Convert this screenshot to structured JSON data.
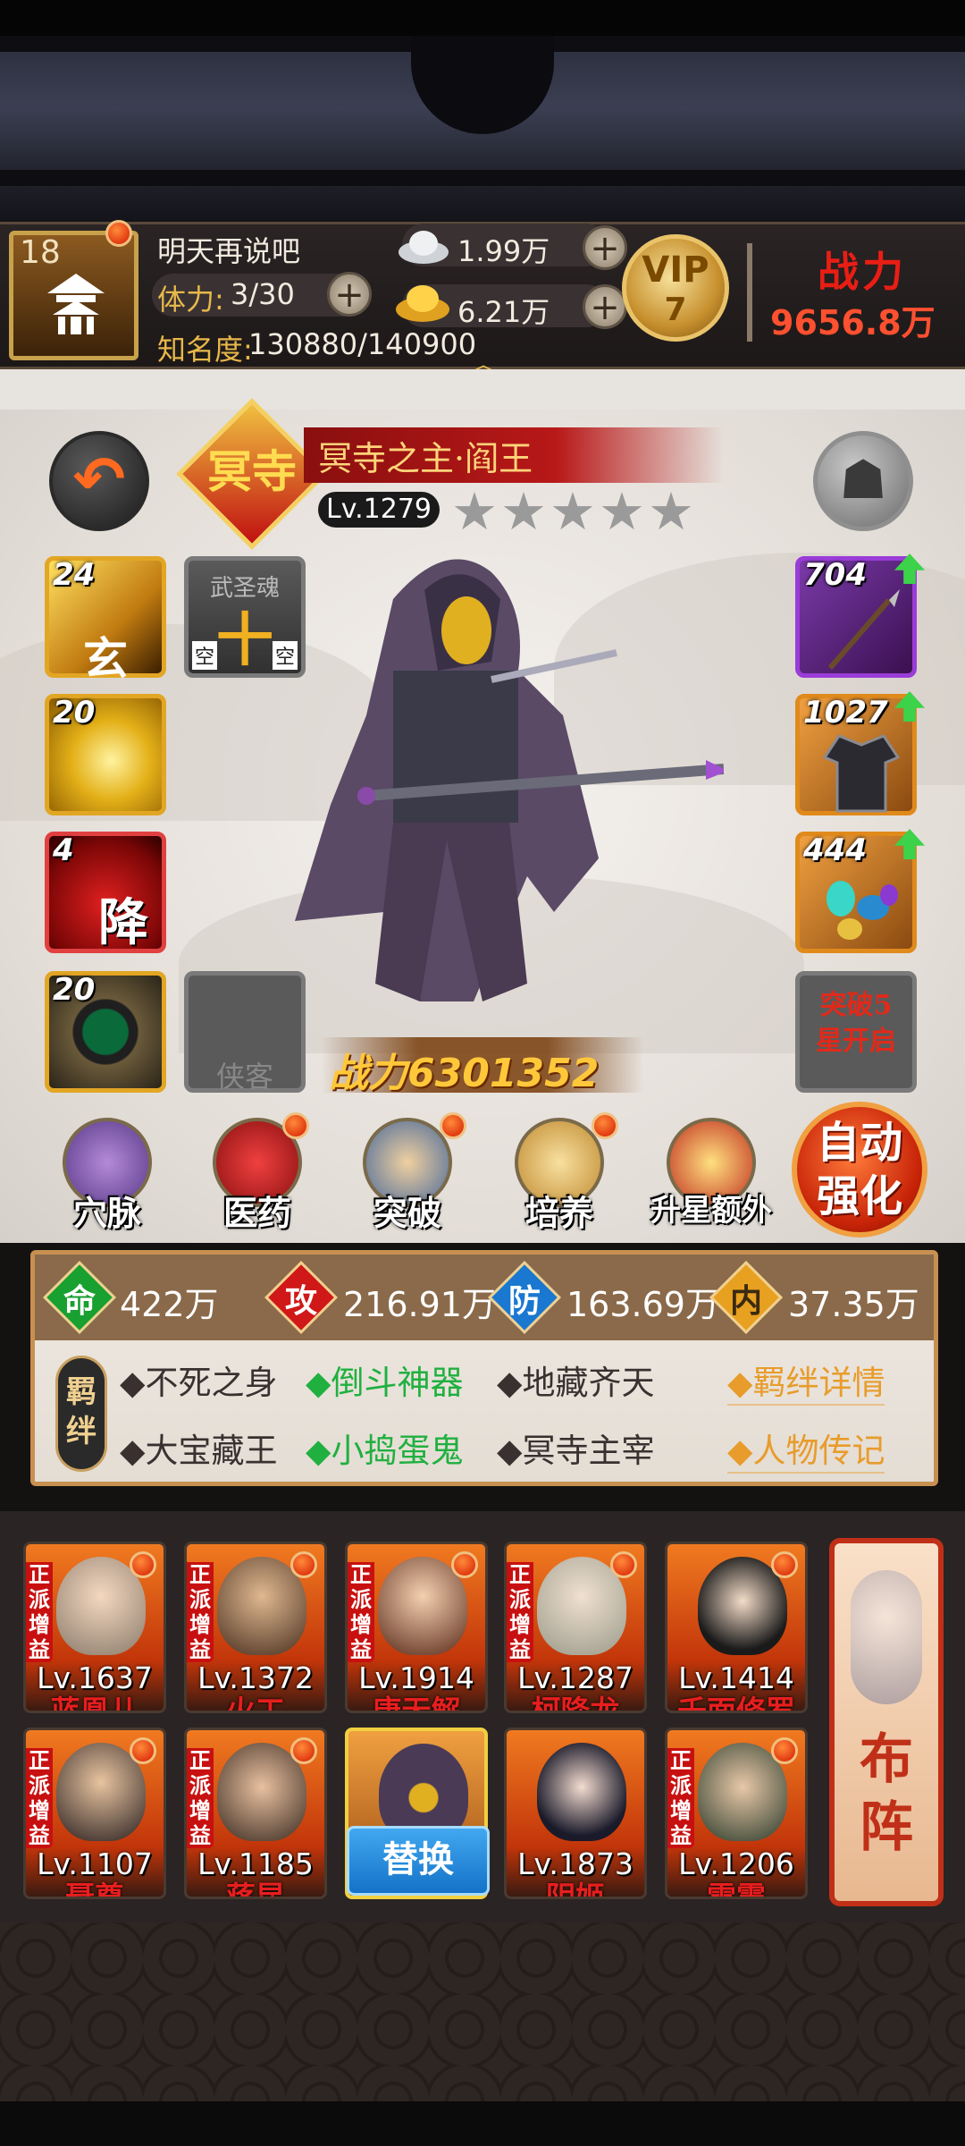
{
  "player": {
    "level": "18",
    "name": "明天再说吧",
    "stamina_label": "体力:",
    "stamina_value": "3/30",
    "fame_label": "知名度:",
    "fame_value": "130880/140900",
    "silver": "1.99万",
    "gold": "6.21万",
    "vip_label": "VIP",
    "vip_level": "7",
    "power_label": "战力",
    "power_value": "9656.8万"
  },
  "hero": {
    "role": "冥寺",
    "name": "冥寺之主·阎王",
    "level": "Lv.1279",
    "stars_total": 5,
    "stars_filled": 0,
    "power": "战力6301352",
    "left_slots": [
      {
        "lv": "24",
        "caption": "玄",
        "icon": "martial-skill-icon"
      },
      {
        "lv": "20",
        "caption": "",
        "icon": "golden-slash-icon"
      },
      {
        "lv": "4",
        "caption": "降",
        "icon": "red-skill-icon"
      },
      {
        "lv": "20",
        "caption": "",
        "icon": "jade-disc-icon"
      }
    ],
    "soul_slot": {
      "title": "武圣魂",
      "glyph": "十",
      "left_tag": "空",
      "right_tag": "空"
    },
    "empty_slot_label": "侠客",
    "right_slots": [
      {
        "lv": "704",
        "icon": "spear-icon"
      },
      {
        "lv": "1027",
        "icon": "armor-icon"
      },
      {
        "lv": "444",
        "icon": "gems-icon"
      }
    ],
    "locked_slot": "突破5星开启"
  },
  "functions": [
    {
      "label": "穴脉",
      "icon": "meridian-icon"
    },
    {
      "label": "医药",
      "icon": "medicine-icon"
    },
    {
      "label": "突破",
      "icon": "breakthrough-icon"
    },
    {
      "label": "培养",
      "icon": "scroll-icon"
    },
    {
      "label": "升星额外",
      "icon": "chest-icon"
    }
  ],
  "auto_button": "自动强化",
  "stats": {
    "hp_label": "命",
    "hp": "422万",
    "atk_label": "攻",
    "atk": "216.91万",
    "def_label": "防",
    "def": "163.69万",
    "int_label": "内",
    "int": "37.35万",
    "bond_label": "羁绊",
    "bonds": [
      "不死之身",
      "倒斗神器",
      "地藏齐天",
      "大宝藏王",
      "小捣蛋鬼",
      "冥寺主宰"
    ],
    "bond_detail": "羁绊详情",
    "biography": "人物传记"
  },
  "roster": [
    {
      "tag": "正派增益",
      "lv": "Lv.1637",
      "name": "蓝凰儿"
    },
    {
      "tag": "正派增益",
      "lv": "Lv.1372",
      "name": "火工"
    },
    {
      "tag": "正派增益",
      "lv": "Lv.1914",
      "name": "唐无解"
    },
    {
      "tag": "正派增益",
      "lv": "Lv.1287",
      "name": "柯降龙"
    },
    {
      "tag": "",
      "lv": "Lv.1414",
      "name": "千面修罗"
    },
    {
      "tag": "正派增益",
      "lv": "Lv.1107",
      "name": "聂尊"
    },
    {
      "tag": "正派增益",
      "lv": "Lv.1185",
      "name": "蒋昆"
    },
    {
      "tag": "",
      "lv": "",
      "name": ""
    },
    {
      "tag": "",
      "lv": "Lv.1873",
      "name": "阴姬"
    },
    {
      "tag": "正派增益",
      "lv": "Lv.1206",
      "name": "雷震"
    }
  ],
  "replace_button": "替换",
  "formation_button": "布阵"
}
